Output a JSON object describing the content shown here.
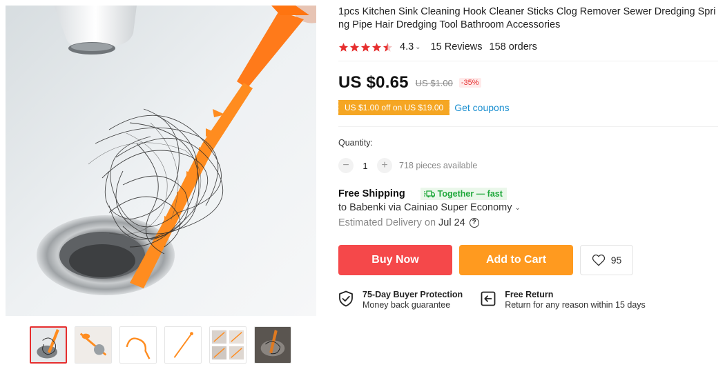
{
  "product": {
    "title": "1pcs Kitchen Sink Cleaning Hook Cleaner Sticks Clog Remover Sewer Dredging Spring Pipe Hair Dredging Tool Bathroom Accessories",
    "rating": "4.3",
    "rating_value": 4.3,
    "reviews": "15 Reviews",
    "orders": "158 orders"
  },
  "price": {
    "current": "US $0.65",
    "original": "US $1.00",
    "discount": "-35%"
  },
  "coupon": {
    "label": "US $1.00 off on US $19.00",
    "get_coupons": "Get coupons"
  },
  "quantity": {
    "label": "Quantity:",
    "value": "1",
    "minus": "−",
    "plus": "+",
    "available": "718 pieces available"
  },
  "shipping": {
    "title": "Free Shipping",
    "badge": "Together — fast",
    "to": "to Babenki via Cainiao Super Economy",
    "estimated_label": "Estimated Delivery on",
    "estimated_date": "Jul 24",
    "help": "?"
  },
  "actions": {
    "buy_now": "Buy Now",
    "add_to_cart": "Add to Cart",
    "wishlist_count": "95"
  },
  "guarantees": [
    {
      "title": "75-Day Buyer Protection",
      "subtitle": "Money back guarantee",
      "icon": "shield-check-icon"
    },
    {
      "title": "Free Return",
      "subtitle": "Return for any reason within 15 days",
      "icon": "return-arrow-icon"
    }
  ],
  "colors": {
    "star": "#e62e2e",
    "buy_now": "#f5484a",
    "add_to_cart": "#ff9a1f",
    "coupon": "#f5a623",
    "link": "#1b8fd0",
    "together": "#1fa83b"
  },
  "gallery": {
    "thumbnail_count": 6,
    "active_index": 0
  }
}
